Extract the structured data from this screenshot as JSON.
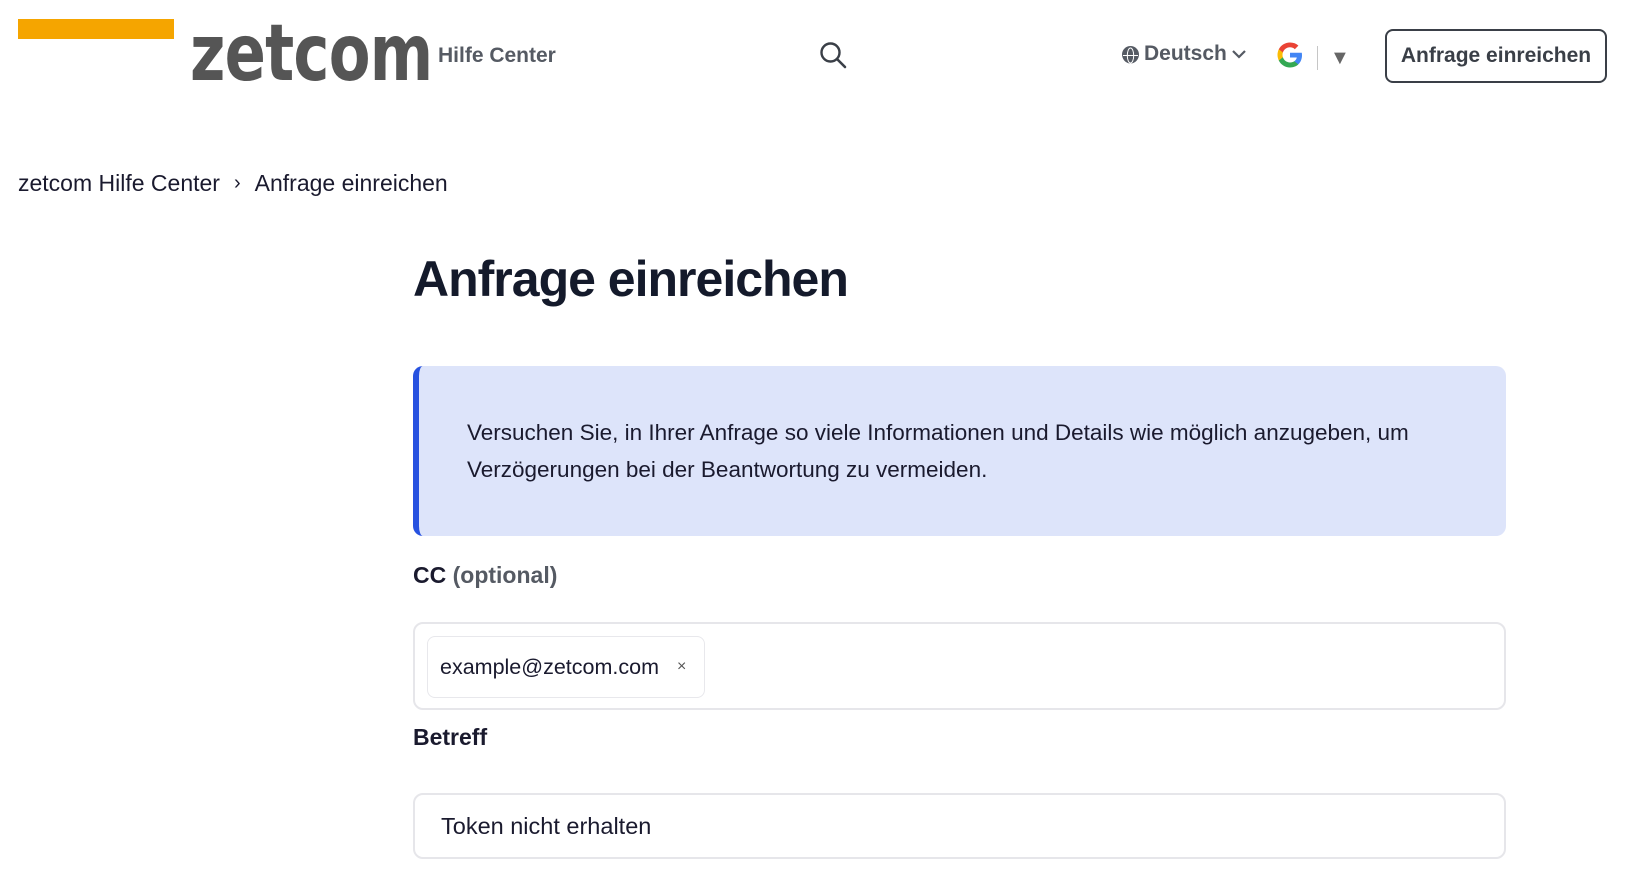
{
  "header": {
    "logo_text": "zetcom",
    "help_center_label": "Hilfe Center",
    "language_label": "Deutsch",
    "google_letter": "G",
    "google_caret": "▼",
    "submit_request_label": "Anfrage einreichen"
  },
  "breadcrumb": {
    "home_label": "zetcom Hilfe Center",
    "separator": "›",
    "current_label": "Anfrage einreichen"
  },
  "main": {
    "title": "Anfrage einreichen",
    "notice_text": "Versuchen Sie, in Ihrer Anfrage so viele Informationen und Details wie möglich anzugeben, um Verzögerungen bei der Beantwortung zu vermeiden.",
    "cc": {
      "label": "CC",
      "optional_label": "(optional)",
      "tag_value": "example@zetcom.com",
      "tag_remove": "×"
    },
    "subject": {
      "label": "Betreff",
      "value": "Token nicht erhalten"
    }
  },
  "colors": {
    "logo_accent": "#f5a500",
    "notice_background": "#dde4fa",
    "notice_border": "#2752e0"
  },
  "icons": [
    "search-icon",
    "globe-icon",
    "chevron-down-icon",
    "google-translate-icon",
    "close-icon"
  ]
}
